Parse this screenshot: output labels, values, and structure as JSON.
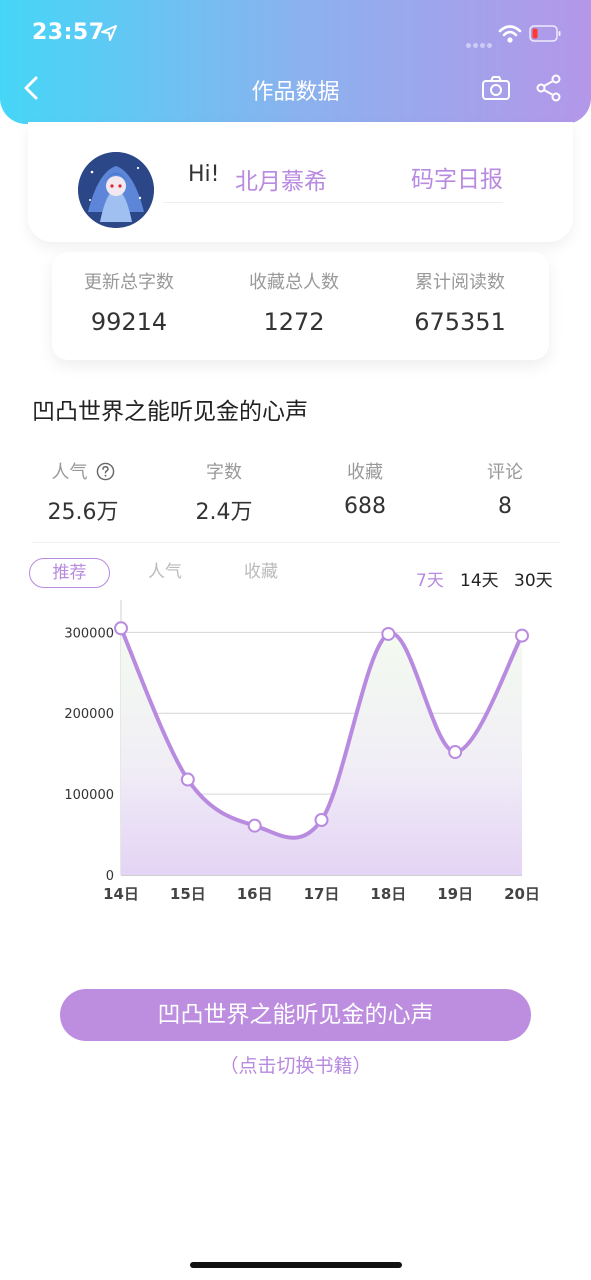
{
  "status_bar": {
    "time": "23:57"
  },
  "nav": {
    "title": "作品数据"
  },
  "profile": {
    "greeting": "Hi!",
    "username": "北月慕希",
    "daily_report": "码字日报"
  },
  "totals": [
    {
      "label": "更新总字数",
      "value": "99214"
    },
    {
      "label": "收藏总人数",
      "value": "1272"
    },
    {
      "label": "累计阅读数",
      "value": "675351"
    }
  ],
  "book": {
    "title": "凹凸世界之能听见金的心声"
  },
  "metrics": [
    {
      "label": "人气",
      "value": "25.6万"
    },
    {
      "label": "字数",
      "value": "2.4万"
    },
    {
      "label": "收藏",
      "value": "688"
    },
    {
      "label": "评论",
      "value": "8"
    }
  ],
  "chart_tabs": [
    {
      "label": "推荐",
      "active": true
    },
    {
      "label": "人气",
      "active": false
    },
    {
      "label": "收藏",
      "active": false
    }
  ],
  "ranges": [
    {
      "label": "7天",
      "active": true
    },
    {
      "label": "14天",
      "active": false
    },
    {
      "label": "30天",
      "active": false
    }
  ],
  "colors": {
    "accent": "#b88ae0",
    "line": "#b98be0"
  },
  "chart_data": {
    "type": "line",
    "categories": [
      "14日",
      "15日",
      "16日",
      "17日",
      "18日",
      "19日",
      "20日"
    ],
    "series": [
      {
        "values": [
          305000,
          118000,
          61000,
          68000,
          298000,
          152000,
          296000
        ]
      }
    ],
    "y_ticks": [
      0,
      100000,
      200000,
      300000
    ],
    "ylim": [
      0,
      340000
    ],
    "grid": true,
    "smooth": true
  },
  "switch": {
    "button_label": "凹凸世界之能听见金的心声",
    "hint": "（点击切换书籍）"
  }
}
